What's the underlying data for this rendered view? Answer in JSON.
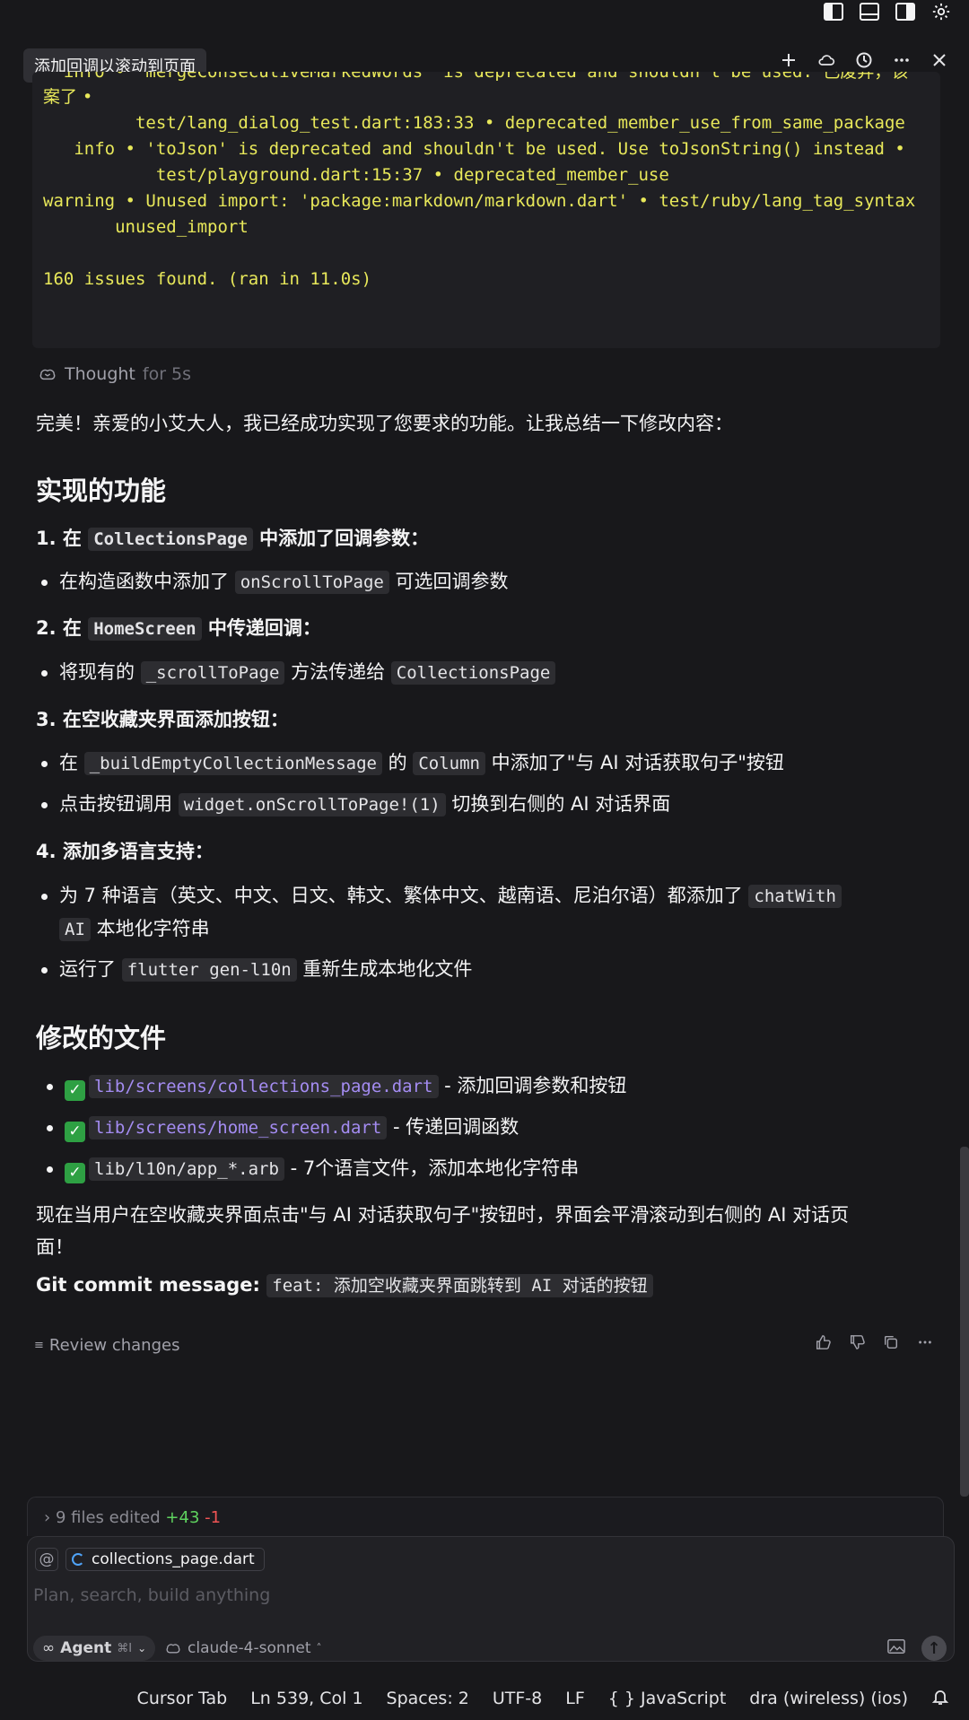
{
  "tab": {
    "title": "添加回调以滚动到页面",
    "actions": [
      "plus-icon",
      "cloud-icon",
      "history-icon",
      "more-icon",
      "close-icon"
    ]
  },
  "terminal": {
    "lines": [
      "  info • 'mergeConsecutiveMarkedWords' is deprecated and shouldn't be used. 已废弃，该",
      "案了 •",
      "         test/lang_dialog_test.dart:183:33 • deprecated_member_use_from_same_package",
      "   info • 'toJson' is deprecated and shouldn't be used. Use toJsonString() instead •",
      "           test/playground.dart:15:37 • deprecated_member_use",
      "warning • Unused import: 'package:markdown/markdown.dart' • test/ruby/lang_tag_syntax",
      "       unused_import",
      "",
      "160 issues found. (ran in 11.0s)"
    ]
  },
  "thought": {
    "label": "Thought",
    "duration": "for 5s"
  },
  "summary": {
    "intro": "完美！亲爱的小艾大人，我已经成功实现了您要求的功能。让我总结一下修改内容：",
    "h_features": "实现的功能",
    "item1": {
      "pre": "1. 在 ",
      "code": "CollectionsPage",
      "post": " 中添加了回调参数："
    },
    "item1_b1": {
      "pre": "在构造函数中添加了 ",
      "code": "onScrollToPage",
      "post": " 可选回调参数"
    },
    "item2": {
      "pre": "2. 在 ",
      "code": "HomeScreen",
      "post": " 中传递回调："
    },
    "item2_b1": {
      "pre": "将现有的 ",
      "code": "_scrollToPage",
      "mid": " 方法传递给 ",
      "code2": "CollectionsPage"
    },
    "item3": "3. 在空收藏夹界面添加按钮：",
    "item3_b1": {
      "pre": "在 ",
      "code": "_buildEmptyCollectionMessage",
      "mid": " 的 ",
      "code2": "Column",
      "post": " 中添加了\"与 AI 对话获取句子\"按钮"
    },
    "item3_b2": {
      "pre": "点击按钮调用 ",
      "code": "widget.onScrollToPage!(1)",
      "post": " 切换到右侧的 AI 对话界面"
    },
    "item4": "4. 添加多语言支持：",
    "item4_b1": {
      "pre": "为 7 种语言（英文、中文、日文、韩文、繁体中文、越南语、尼泊尔语）都添加了 ",
      "code": "chatWith",
      "code_cont": "AI",
      "post": " 本地化字符串"
    },
    "item4_b2": {
      "pre": "运行了 ",
      "code": "flutter gen-l10n",
      "post": " 重新生成本地化文件"
    },
    "h_files": "修改的文件",
    "files": [
      {
        "path": "lib/screens/collections_page.dart",
        "desc": " - 添加回调参数和按钮",
        "link": true
      },
      {
        "path": "lib/screens/home_screen.dart",
        "desc": " - 传递回调函数",
        "link": true
      },
      {
        "path": "lib/l10n/app_*.arb",
        "desc": " - 7个语言文件，添加本地化字符串",
        "link": false
      }
    ],
    "outro_1": "现在当用户在空收藏夹界面点击\"与 AI 对话获取句子\"按钮时，界面会平滑滚动到右侧的 AI 对话页",
    "outro_2": "面！",
    "commit_label": "Git commit message:",
    "commit_msg": "feat: 添加空收藏夹界面跳转到 AI 对话的按钮"
  },
  "review_label": "Review changes",
  "files_edited": {
    "count": "9 files edited",
    "plus": "+43",
    "minus": "-1"
  },
  "composer": {
    "at": "@",
    "file_chip": "collections_page.dart",
    "placeholder": "Plan, search, build anything",
    "agent": "Agent",
    "agent_kbd": "⌘I",
    "model": "claude-4-sonnet"
  },
  "status": {
    "tab": "Cursor Tab",
    "position": "Ln 539, Col 1",
    "spaces": "Spaces: 2",
    "encoding": "UTF-8",
    "eol": "LF",
    "language": "JavaScript",
    "device": "dra (wireless) (ios)"
  }
}
